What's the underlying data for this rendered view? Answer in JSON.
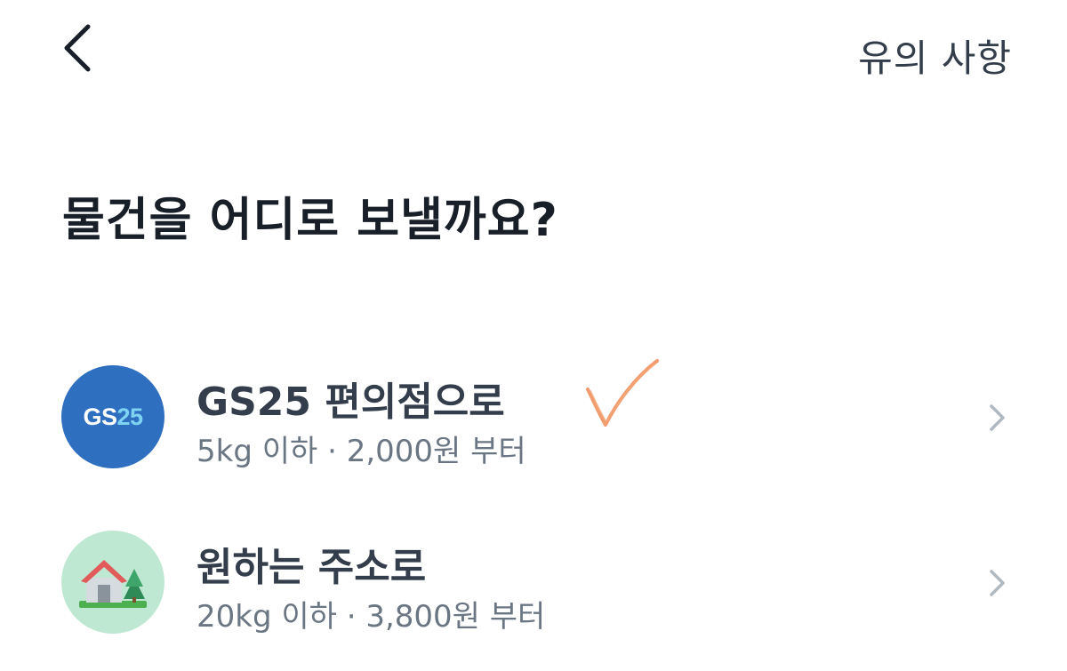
{
  "header": {
    "back_icon": "chevron-left-icon",
    "notice_label": "유의 사항"
  },
  "title": "물건을 어디로 보낼까요?",
  "options": [
    {
      "id": "gs25",
      "icon": "gs25-logo",
      "logo_text": "GS",
      "logo_num": "25",
      "title": "GS25 편의점으로",
      "subtitle": "5kg 이하 · 2,000원 부터",
      "chevron_icon": "chevron-right-icon",
      "color": "#2e6fbf"
    },
    {
      "id": "address",
      "icon": "house-icon",
      "title": "원하는 주소로",
      "subtitle": "20kg 이하 · 3,800원 부터",
      "chevron_icon": "chevron-right-icon",
      "color": "#bfe8d3"
    }
  ],
  "annotation": {
    "icon": "handwritten-checkmark",
    "color": "#f08a55"
  }
}
